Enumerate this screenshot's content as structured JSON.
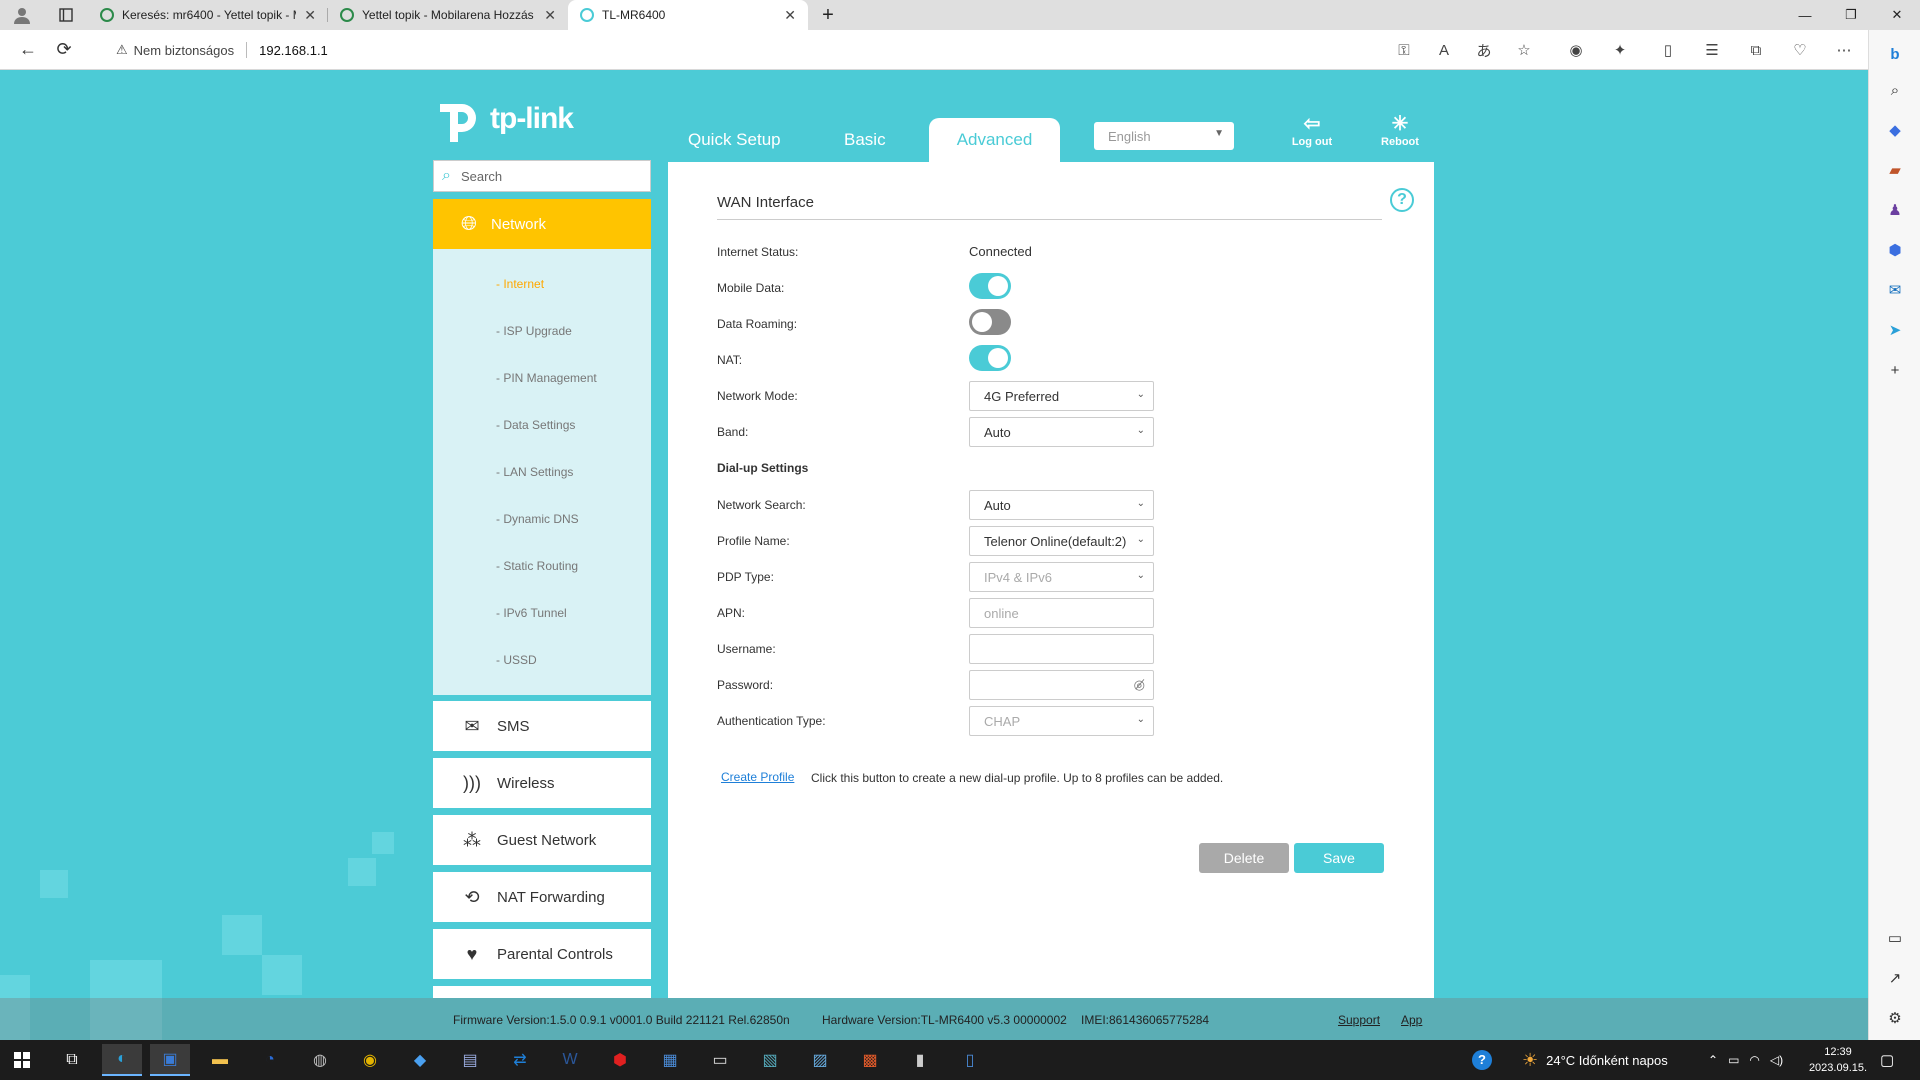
{
  "browser": {
    "tabs": [
      {
        "title": "Keresés: mr6400 - Yettel topik - M"
      },
      {
        "title": "Yettel topik - Mobilarena Hozzás"
      },
      {
        "title": "TL-MR6400"
      }
    ],
    "new_tab": "+",
    "security_label": "Nem biztonságos",
    "url": "192.168.1.1"
  },
  "router": {
    "logo_text": "tp-link",
    "tabs": {
      "quick_setup": "Quick Setup",
      "basic": "Basic",
      "advanced": "Advanced"
    },
    "language": "English",
    "logout_label": "Log out",
    "reboot_label": "Reboot",
    "search_placeholder": "Search",
    "sidebar": {
      "active_section": "Network",
      "sub_items": [
        "- Internet",
        "- ISP Upgrade",
        "- PIN Management",
        "- Data Settings",
        "- LAN Settings",
        "- Dynamic DNS",
        "- Static Routing",
        "- IPv6 Tunnel",
        "- USSD"
      ],
      "active_sub_index": 0,
      "sections": [
        "SMS",
        "Wireless",
        "Guest Network",
        "NAT Forwarding",
        "Parental Controls"
      ]
    },
    "panel": {
      "title": "WAN Interface",
      "internet_status_label": "Internet Status:",
      "internet_status_value": "Connected",
      "mobile_data_label": "Mobile Data:",
      "mobile_data_on": true,
      "data_roaming_label": "Data Roaming:",
      "data_roaming_on": false,
      "nat_label": "NAT:",
      "nat_on": true,
      "network_mode_label": "Network Mode:",
      "network_mode_value": "4G Preferred",
      "band_label": "Band:",
      "band_value": "Auto",
      "dialup_heading": "Dial-up Settings",
      "network_search_label": "Network Search:",
      "network_search_value": "Auto",
      "profile_name_label": "Profile Name:",
      "profile_name_value": "Telenor Online(default:2)",
      "pdp_type_label": "PDP Type:",
      "pdp_type_value": "IPv4 & IPv6",
      "apn_label": "APN:",
      "apn_value": "online",
      "username_label": "Username:",
      "username_value": "",
      "password_label": "Password:",
      "password_value": "",
      "auth_type_label": "Authentication Type:",
      "auth_type_value": "CHAP",
      "create_profile_label": "Create Profile",
      "create_profile_note": "Click this button to create a new dial-up profile. Up to 8 profiles can be added.",
      "delete_label": "Delete",
      "save_label": "Save"
    },
    "footer": {
      "firmware": "Firmware Version:1.5.0 0.9.1 v0001.0 Build 221121 Rel.62850n",
      "hardware": "Hardware Version:TL-MR6400 v5.3 00000002",
      "imei": "IMEI:861436065775284",
      "support": "Support",
      "app": "App"
    }
  },
  "taskbar": {
    "weather": "24°C  Időnként napos",
    "time": "12:39",
    "date": "2023.09.15."
  },
  "colors": {
    "accent": "#4acbd6",
    "active_nav": "#ffc400",
    "active_sub": "#ffa800"
  }
}
